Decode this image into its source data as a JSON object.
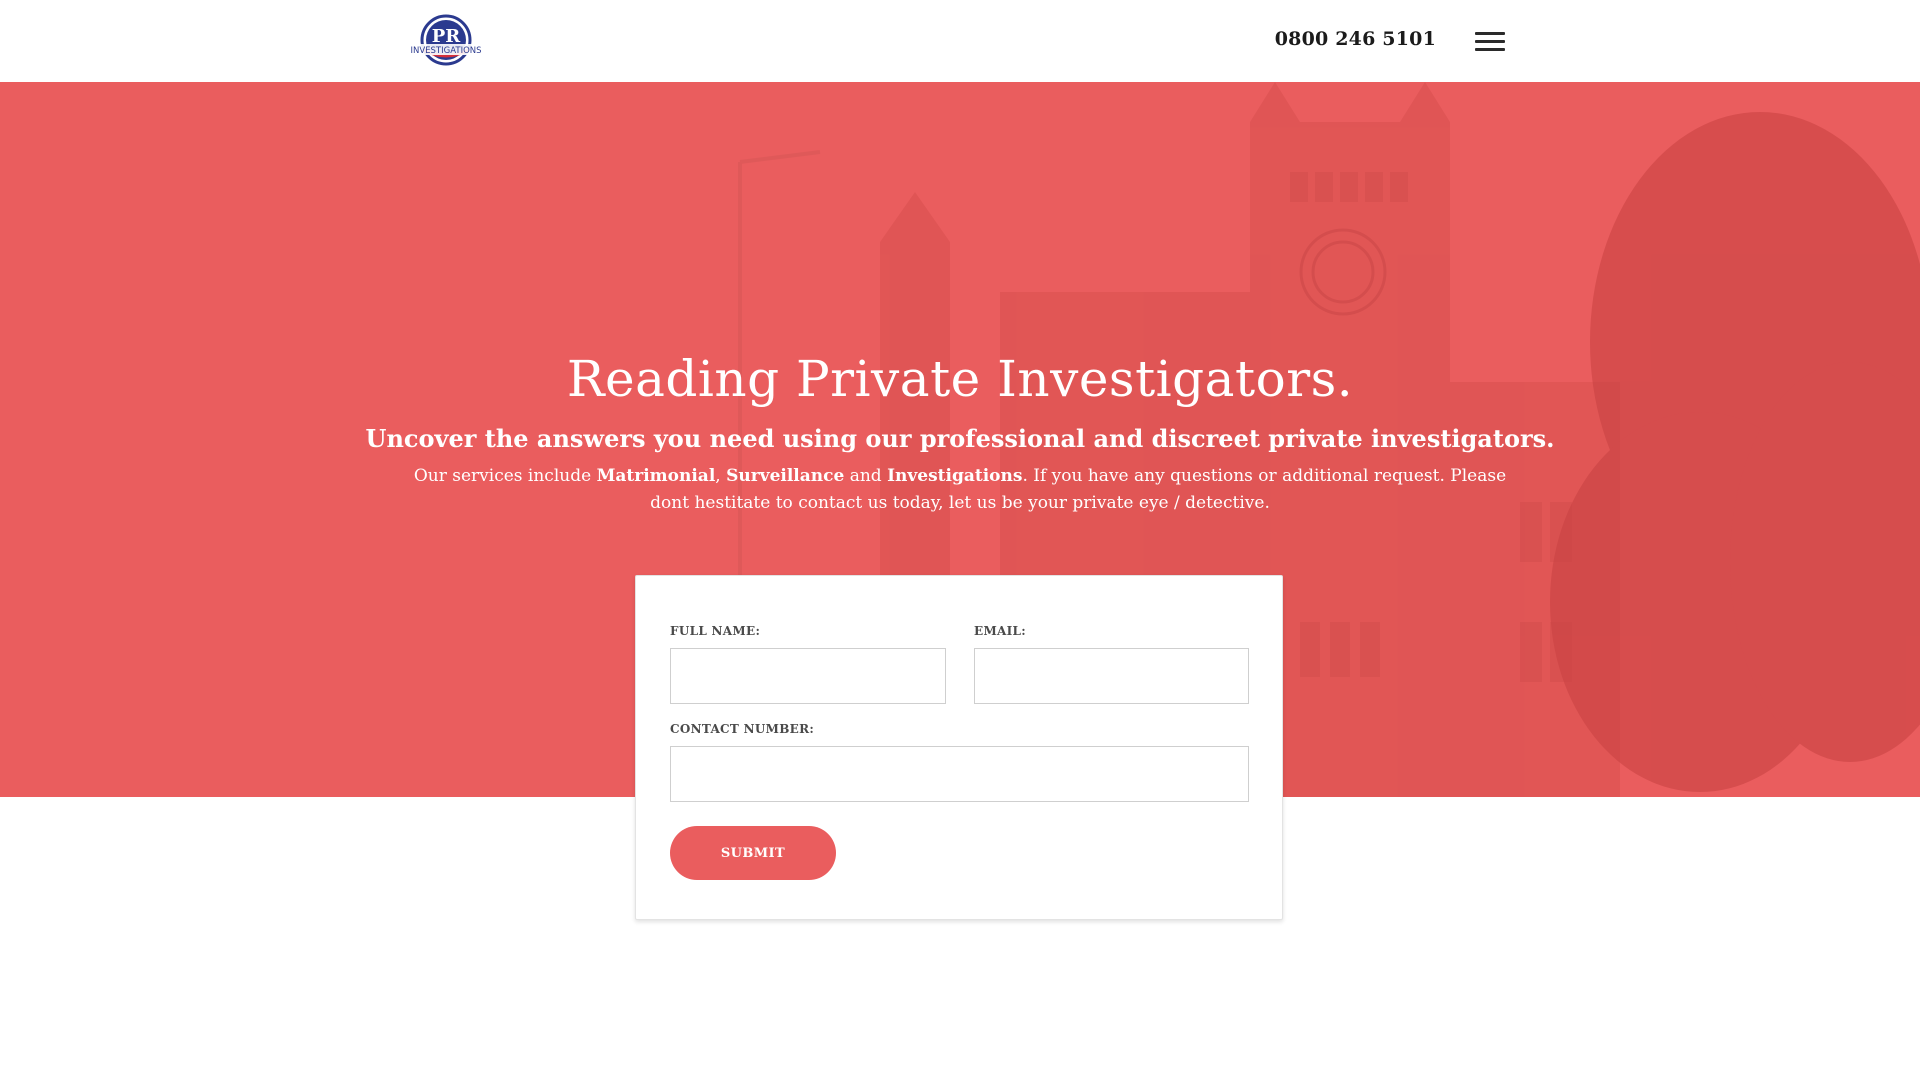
{
  "header": {
    "logo": {
      "text_main": "PR",
      "text_sub": "INVESTIGATIONS",
      "color_primary": "#2b3a8f",
      "color_accent": "#d32f3a"
    },
    "phone": "0800 246 5101",
    "menu_icon": "hamburger-menu-icon"
  },
  "hero": {
    "background_color": "#ea5d5e",
    "title": "Reading Private Investigators.",
    "subtitle": "Uncover the answers you need using our professional and discreet private investigators.",
    "text": {
      "part1": "Our services include ",
      "bold1": "Matrimonial",
      "sep1": ", ",
      "bold2": "Surveillance",
      "sep2": " and ",
      "bold3": "Investigations",
      "part2": ". If you have any questions or additional request. Please dont hestitate to contact us today, let us be your private eye / detective."
    }
  },
  "form": {
    "full_name_label": "FULL NAME:",
    "full_name_value": "",
    "email_label": "EMAIL:",
    "email_value": "",
    "contact_label": "CONTACT NUMBER:",
    "contact_value": "",
    "submit_label": "SUBMIT"
  }
}
